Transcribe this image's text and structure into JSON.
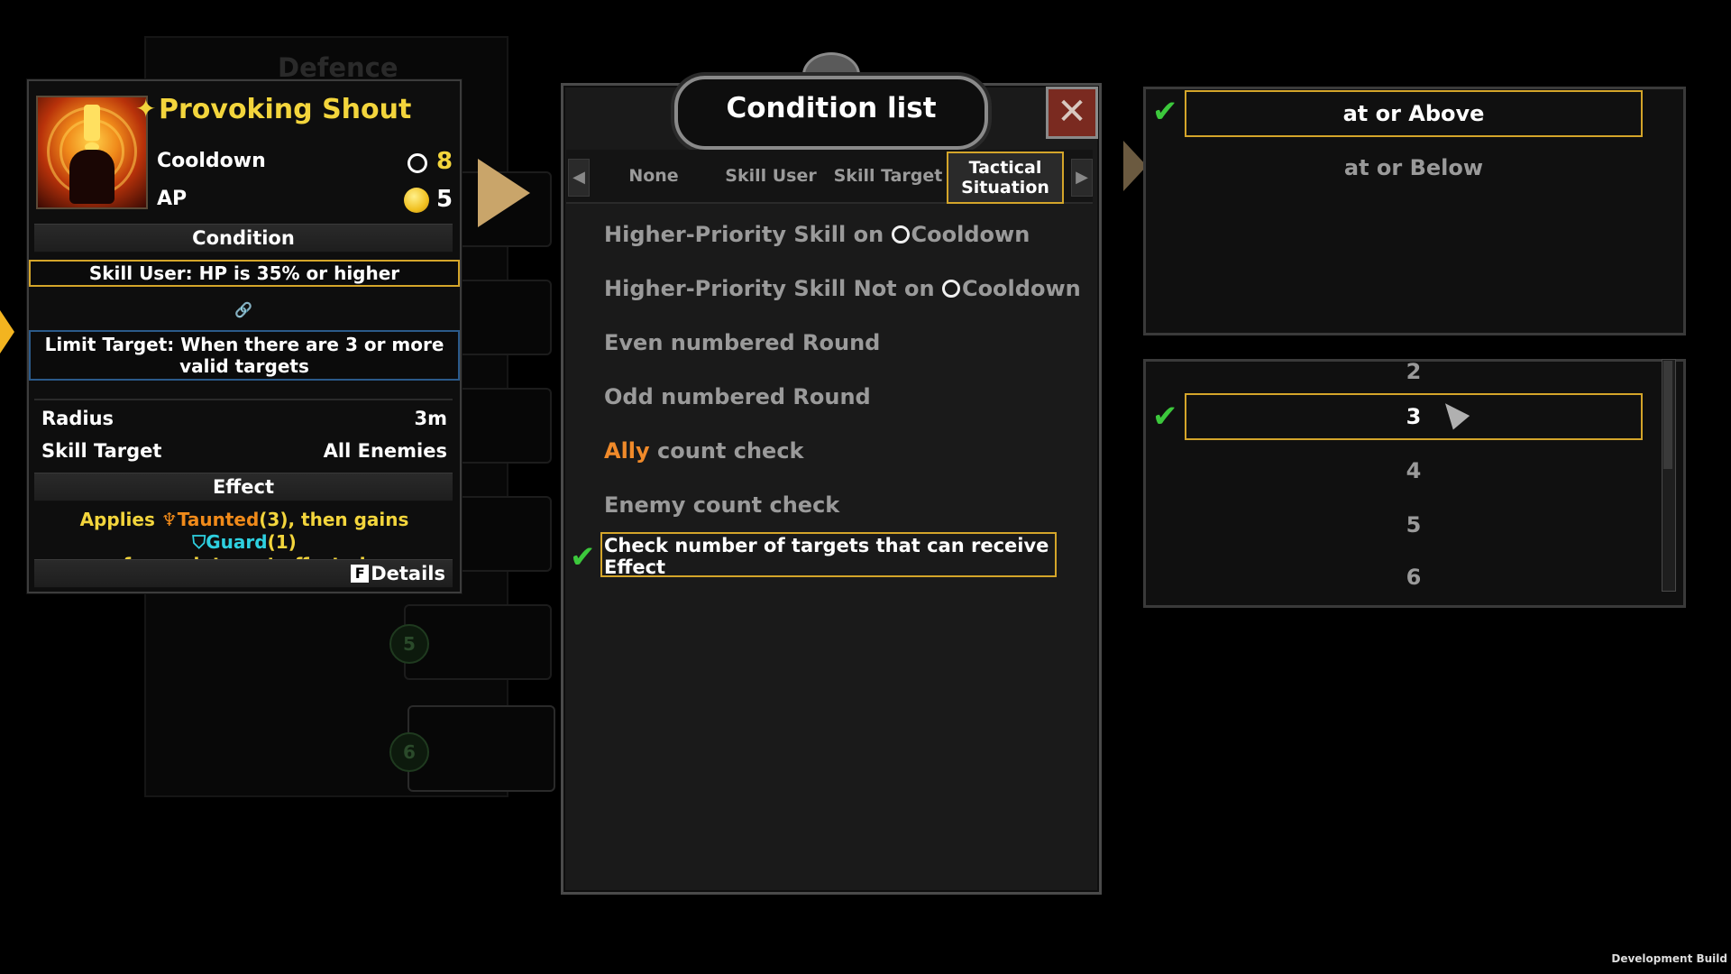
{
  "background": {
    "panel_title": "Defence",
    "slot_numbers": [
      "5",
      "6"
    ]
  },
  "skill": {
    "name": "Provoking Shout",
    "cooldown_label": "Cooldown",
    "cooldown_value": "8",
    "ap_label": "AP",
    "ap_value": "5",
    "condition_header": "Condition",
    "condition_text": "Skill User: HP is 35% or higher",
    "link_icon": "🔗",
    "limit_text": "Limit Target: When there are 3 or more valid targets",
    "radius_label": "Radius",
    "radius_value": "3m",
    "target_label": "Skill Target",
    "target_value": "All Enemies",
    "effect_header": "Effect",
    "effect_applies": "Applies ",
    "effect_taunted": "Taunted",
    "effect_taunted_count": "(3)",
    "effect_then": ", then gains ",
    "effect_guard": "Guard",
    "effect_guard_count": "(1)",
    "effect_line2": "for each target affected",
    "details_key": "F",
    "details_label": "Details"
  },
  "condition_list": {
    "title": "Condition list",
    "close_label": "✕",
    "tabs": [
      {
        "label": "None"
      },
      {
        "label": "Skill User"
      },
      {
        "label": "Skill Target"
      },
      {
        "label": "Tactical Situation"
      }
    ],
    "options": {
      "o1_a": "Higher-Priority Skill on ",
      "o1_b": "Cooldown",
      "o2_a": "Higher-Priority Skill Not on ",
      "o2_b": "Cooldown",
      "o3": "Even numbered Round",
      "o4": "Odd numbered Round",
      "o5_a": "Ally",
      "o5_b": " count check",
      "o6": "Enemy count check",
      "o7": "Check number of targets that can receive Effect"
    }
  },
  "comparison": {
    "options": [
      "at or Above",
      "at or Below"
    ],
    "selected": "at or Above"
  },
  "number_picker": {
    "values": [
      "2",
      "3",
      "4",
      "5",
      "6"
    ],
    "selected": "3"
  },
  "footer": {
    "build_label": "Development Build"
  },
  "colors": {
    "accent_gold": "#d4a52a",
    "skill_name": "#f3d53c",
    "taunt": "#f08a1a",
    "guard": "#2ed0e0",
    "check": "#3cc83c"
  }
}
